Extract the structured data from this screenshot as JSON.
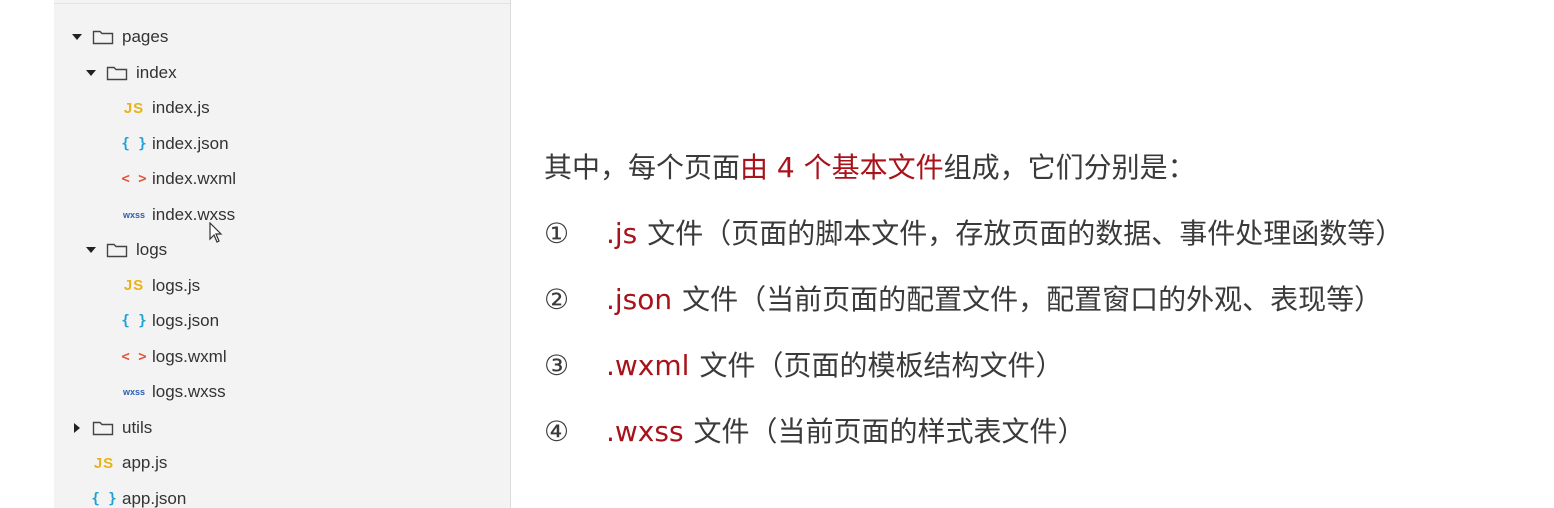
{
  "explorer": {
    "tree": [
      {
        "kind": "folder",
        "label": "pages",
        "expanded": true,
        "depth": 0
      },
      {
        "kind": "folder",
        "label": "index",
        "expanded": true,
        "depth": 1
      },
      {
        "kind": "file",
        "icon": "js",
        "icon_text": "JS",
        "label": "index.js",
        "depth": 2
      },
      {
        "kind": "file",
        "icon": "json",
        "icon_text": "{ }",
        "label": "index.json",
        "depth": 2
      },
      {
        "kind": "file",
        "icon": "wxml",
        "icon_text": "< >",
        "label": "index.wxml",
        "depth": 2
      },
      {
        "kind": "file",
        "icon": "wxss",
        "icon_text": "wxss",
        "label": "index.wxss",
        "depth": 2
      },
      {
        "kind": "folder",
        "label": "logs",
        "expanded": true,
        "depth": 1
      },
      {
        "kind": "file",
        "icon": "js",
        "icon_text": "JS",
        "label": "logs.js",
        "depth": 2
      },
      {
        "kind": "file",
        "icon": "json",
        "icon_text": "{ }",
        "label": "logs.json",
        "depth": 2
      },
      {
        "kind": "file",
        "icon": "wxml",
        "icon_text": "< >",
        "label": "logs.wxml",
        "depth": 2
      },
      {
        "kind": "file",
        "icon": "wxss",
        "icon_text": "wxss",
        "label": "logs.wxss",
        "depth": 2
      },
      {
        "kind": "folder",
        "label": "utils",
        "expanded": false,
        "depth": 0
      },
      {
        "kind": "file",
        "icon": "js",
        "icon_text": "JS",
        "label": "app.js",
        "depth": 0
      },
      {
        "kind": "file",
        "icon": "json",
        "icon_text": "{ }",
        "label": "app.json",
        "depth": 0
      }
    ]
  },
  "content": {
    "intro_before": "其中，每个页面",
    "intro_highlight": "由 4 个基本文件",
    "intro_after": "组成，它们分别是：",
    "items": [
      {
        "num": "①",
        "ext": ".js",
        "desc": "文件（页面的脚本文件，存放页面的数据、事件处理函数等）"
      },
      {
        "num": "②",
        "ext": ".json",
        "desc": "文件（当前页面的配置文件，配置窗口的外观、表现等）"
      },
      {
        "num": "③",
        "ext": ".wxml",
        "desc": "文件（页面的模板结构文件）"
      },
      {
        "num": "④",
        "ext": ".wxss",
        "desc": "文件（当前页面的样式表文件）"
      }
    ]
  },
  "colors": {
    "highlight": "#a8121a",
    "js_icon": "#e8b318",
    "json_icon": "#1ba1d6",
    "wxml_icon": "#e2543b",
    "wxss_icon": "#2b5fb3"
  }
}
